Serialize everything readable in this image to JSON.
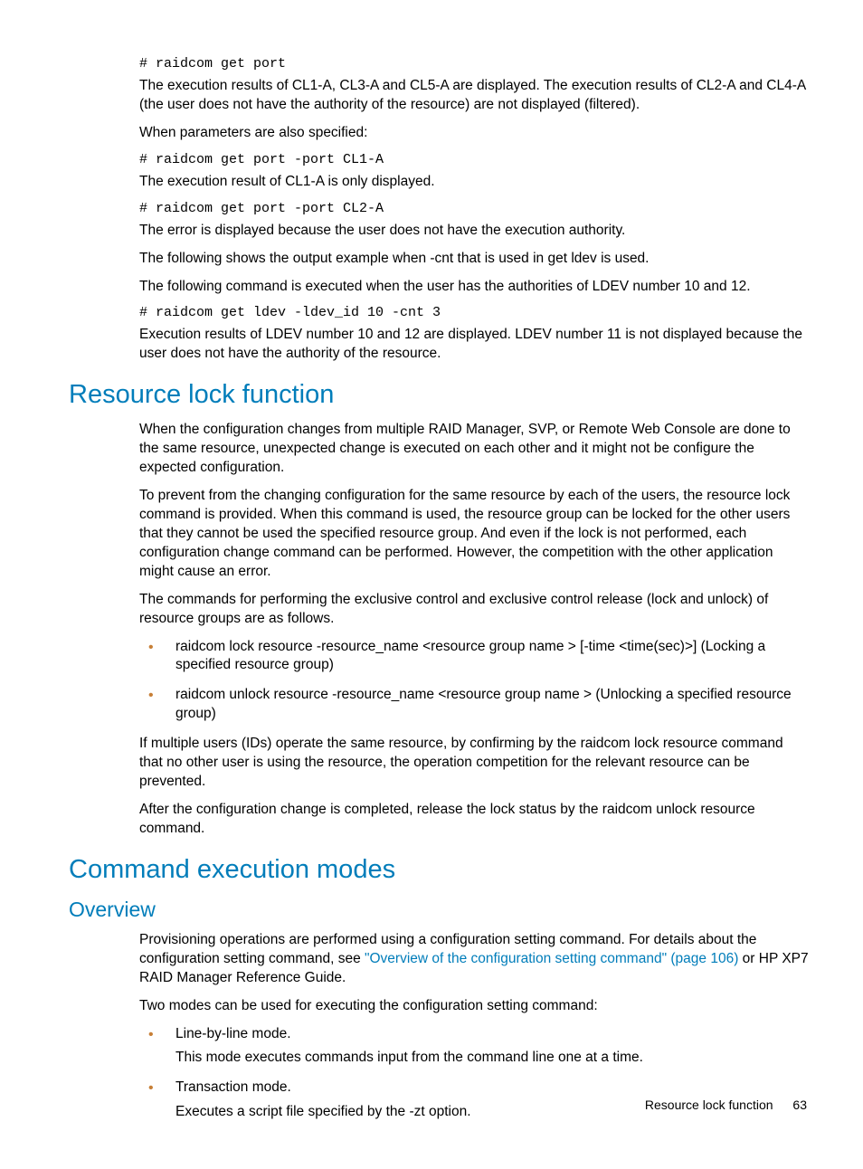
{
  "top": {
    "code1": "# raidcom get port",
    "p1": "The execution results of CL1-A, CL3-A and CL5-A are displayed. The execution results of CL2-A and CL4-A (the user does not have the authority of the resource) are not displayed (filtered).",
    "p2": "When parameters are also specified:",
    "code2": "# raidcom get port -port CL1-A",
    "p3": "The execution result of CL1-A is only displayed.",
    "code3": "# raidcom get port -port CL2-A",
    "p4": "The error is displayed because the user does not have the execution authority.",
    "p5": "The following shows the output example when -cnt that is used in get ldev is used.",
    "p6": "The following command is executed when the user has the authorities of LDEV number 10 and 12.",
    "code4": "# raidcom get ldev -ldev_id 10 -cnt 3",
    "p7": "Execution results of LDEV number 10 and 12 are displayed. LDEV number 11 is not displayed because the user does not have the authority of the resource."
  },
  "section1": {
    "title": "Resource lock function",
    "p1": "When the configuration changes from multiple RAID Manager, SVP, or Remote Web Console are done to the same resource, unexpected change is executed on each other and it might not be configure the expected configuration.",
    "p2": "To prevent from the changing configuration for the same resource by each of the users, the resource lock command is provided. When this command is used, the resource group can be locked for the other users that they cannot be used the specified resource group. And even if the lock is not performed, each configuration change command can be performed. However, the competition with the other application might cause an error.",
    "p3": "The commands for performing the exclusive control and exclusive control release (lock and unlock) of resource groups are as follows.",
    "li1": "raidcom lock resource -resource_name <resource group name > [-time <time(sec)>] (Locking a specified resource group)",
    "li2": "raidcom unlock resource -resource_name <resource group name > (Unlocking a specified resource group)",
    "p4": "If multiple users (IDs) operate the same resource, by confirming by the raidcom lock resource command that no other user is using the resource, the operation competition for the relevant resource can be prevented.",
    "p5": "After the configuration change is completed, release the lock status by the raidcom unlock resource command."
  },
  "section2": {
    "title": "Command execution modes",
    "subtitle": "Overview",
    "p1a": "Provisioning operations are performed using a configuration setting command. For details about the configuration setting command, see ",
    "link": "\"Overview of the configuration setting command\" (page 106)",
    "p1b": " or HP XP7 RAID Manager Reference Guide.",
    "p2": "Two modes can be used for executing the configuration setting command:",
    "li1": "Line-by-line mode.",
    "li1sub": "This mode executes commands input from the command line one at a time.",
    "li2": "Transaction mode.",
    "li2sub": "Executes a script file specified by the -zt option."
  },
  "footer": {
    "label": "Resource lock function",
    "page": "63"
  }
}
